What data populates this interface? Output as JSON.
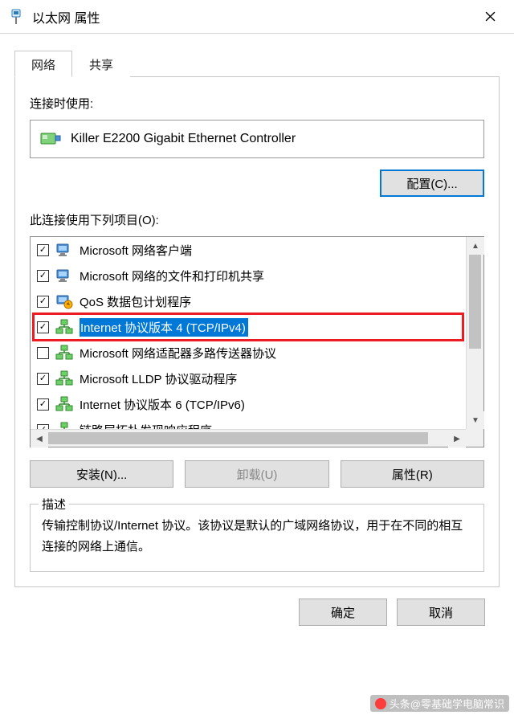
{
  "titlebar": {
    "title": "以太网 属性"
  },
  "tabs": [
    {
      "label": "网络",
      "active": true
    },
    {
      "label": "共享",
      "active": false
    }
  ],
  "connectUsingLabel": "连接时使用:",
  "adapterName": "Killer E2200 Gigabit Ethernet Controller",
  "configureBtn": "配置(C)...",
  "itemsLabel": "此连接使用下列项目(O):",
  "items": [
    {
      "checked": true,
      "icon": "client",
      "label": "Microsoft 网络客户端",
      "selected": false
    },
    {
      "checked": true,
      "icon": "client",
      "label": "Microsoft 网络的文件和打印机共享",
      "selected": false
    },
    {
      "checked": true,
      "icon": "qos",
      "label": "QoS 数据包计划程序",
      "selected": false
    },
    {
      "checked": true,
      "icon": "proto",
      "label": "Internet 协议版本 4 (TCP/IPv4)",
      "selected": true
    },
    {
      "checked": false,
      "icon": "proto",
      "label": "Microsoft 网络适配器多路传送器协议",
      "selected": false
    },
    {
      "checked": true,
      "icon": "proto",
      "label": "Microsoft LLDP 协议驱动程序",
      "selected": false
    },
    {
      "checked": true,
      "icon": "proto",
      "label": "Internet 协议版本 6 (TCP/IPv6)",
      "selected": false
    },
    {
      "checked": true,
      "icon": "proto",
      "label": "链路层拓扑发现响应程序",
      "selected": false
    }
  ],
  "installBtn": "安装(N)...",
  "uninstallBtn": "卸载(U)",
  "propertiesBtn": "属性(R)",
  "descLegend": "描述",
  "descText": "传输控制协议/Internet 协议。该协议是默认的广域网络协议，用于在不同的相互连接的网络上通信。",
  "okBtn": "确定",
  "cancelBtn": "取消",
  "watermark": "头条@零基础学电脑常识"
}
